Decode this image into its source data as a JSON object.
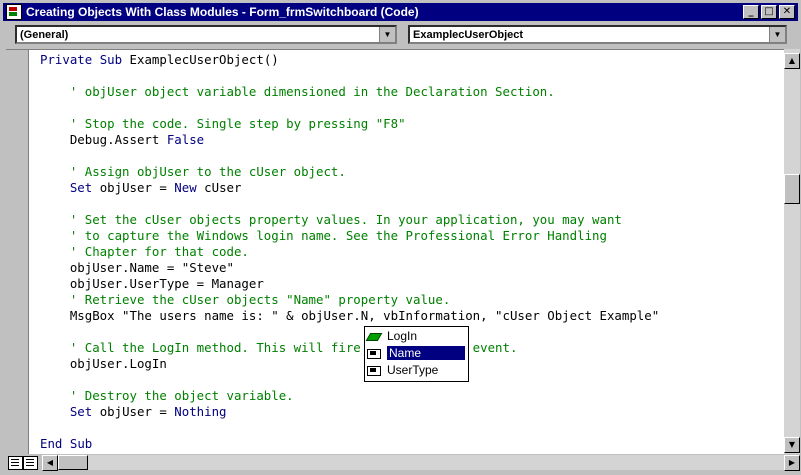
{
  "window": {
    "title": "Creating Objects With Class Modules - Form_frmSwitchboard (Code)",
    "buttons": [
      "_",
      "□",
      "✕"
    ]
  },
  "combos": {
    "object": "(General)",
    "procedure": "ExamplecUserObject"
  },
  "code_lines": [
    {
      "type": "code",
      "text": "Private Sub ExamplecUserObject()"
    },
    {
      "type": "blank",
      "text": ""
    },
    {
      "type": "comment",
      "text": "    ' objUser object variable dimensioned in the Declaration Section."
    },
    {
      "type": "blank",
      "text": ""
    },
    {
      "type": "comment",
      "text": "    ' Stop the code. Single step by pressing \"F8\""
    },
    {
      "type": "code",
      "text": "    Debug.Assert False"
    },
    {
      "type": "blank",
      "text": ""
    },
    {
      "type": "comment",
      "text": "    ' Assign objUser to the cUser object."
    },
    {
      "type": "code",
      "text": "    Set objUser = New cUser"
    },
    {
      "type": "blank",
      "text": ""
    },
    {
      "type": "comment",
      "text": "    ' Set the cUser objects property values. In your application, you may want"
    },
    {
      "type": "comment",
      "text": "    ' to capture the Windows login name. See the Professional Error Handling"
    },
    {
      "type": "comment",
      "text": "    ' Chapter for that code."
    },
    {
      "type": "code",
      "text": "    objUser.Name = \"Steve\""
    },
    {
      "type": "code",
      "text": "    objUser.UserType = Manager"
    },
    {
      "type": "comment",
      "text": "    ' Retrieve the cUser objects \"Name\" property value."
    },
    {
      "type": "code",
      "text": "    MsgBox \"The users name is: \" & objUser.N, vbInformation, \"cUser Object Example\""
    },
    {
      "type": "blank",
      "text": ""
    },
    {
      "type": "comment",
      "text": "    ' Call the LogIn method. This will fire the \"Welcome\" event."
    },
    {
      "type": "code",
      "text": "    objUser.LogIn"
    },
    {
      "type": "blank",
      "text": ""
    },
    {
      "type": "comment",
      "text": "    ' Destroy the object variable."
    },
    {
      "type": "code",
      "text": "    Set objUser = Nothing"
    },
    {
      "type": "blank",
      "text": ""
    },
    {
      "type": "code",
      "text": "End Sub"
    }
  ],
  "autocomplete": {
    "items": [
      {
        "label": "LogIn",
        "icon": "method-icon",
        "selected": false
      },
      {
        "label": "Name",
        "icon": "property-icon",
        "selected": true
      },
      {
        "label": "UserType",
        "icon": "property-icon",
        "selected": false
      }
    ]
  }
}
